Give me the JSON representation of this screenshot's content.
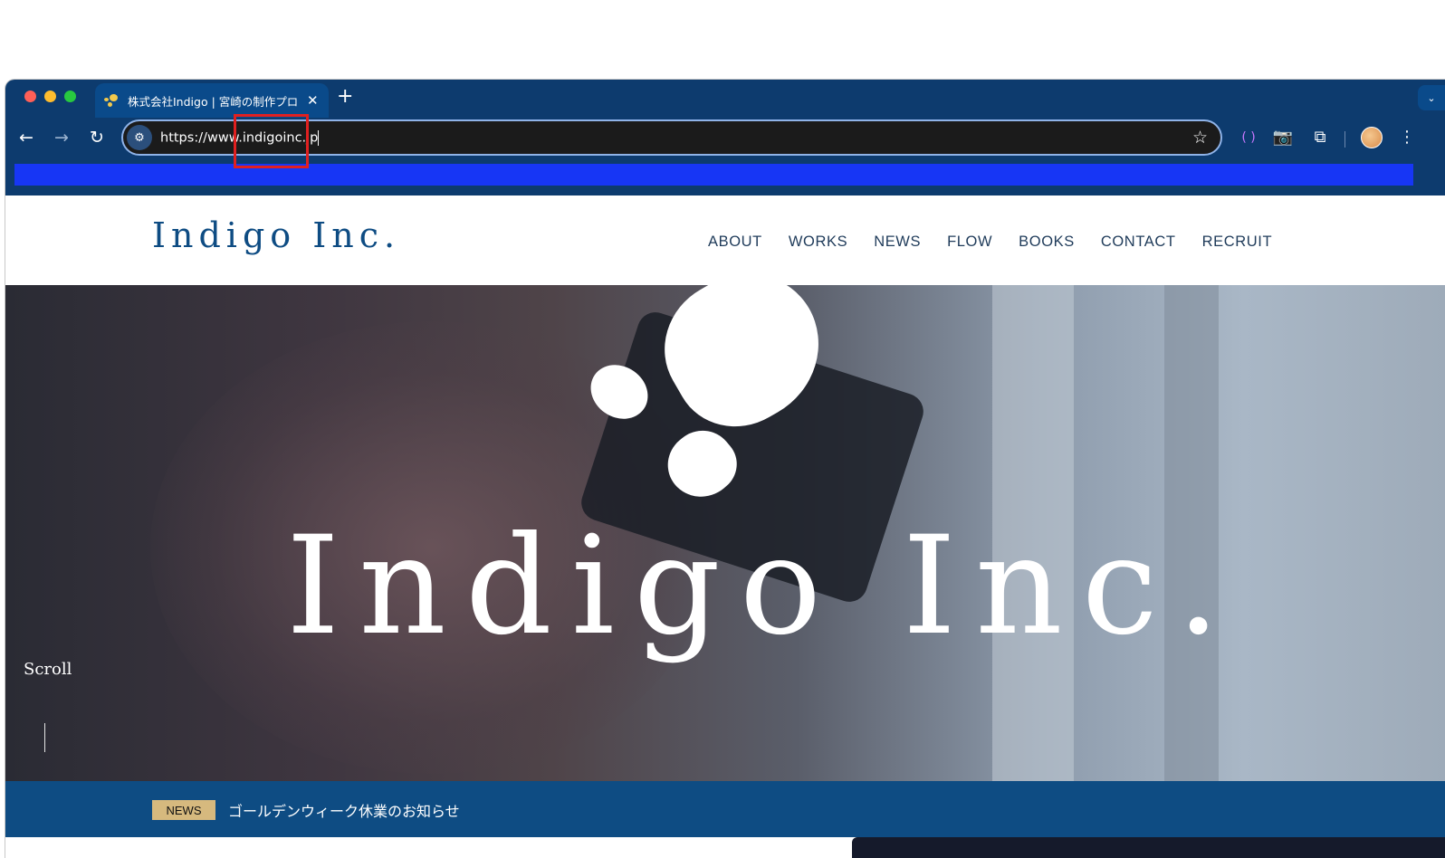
{
  "browser": {
    "tab_title": "株式会社Indigo | 宮崎の制作プロ",
    "tab_close": "✕",
    "new_tab": "+",
    "tab_dropdown": "⌄",
    "url": "https://www.indigoinc.jp",
    "url_typed": "https://www.indigoinc.jp",
    "icons": {
      "back": "←",
      "forward": "→",
      "reload": "↻",
      "site_info": "⚙",
      "bookmark": "☆",
      "extension_1": "( )",
      "extension_2": "📷",
      "extensions": "⧉",
      "menu": "⋮"
    },
    "colors": {
      "chrome": "#0d3b6e",
      "bookmark_bar": "#1736f5",
      "highlight": "#e02020"
    }
  },
  "site": {
    "logo": "Indigo Inc.",
    "nav": [
      "ABOUT",
      "WORKS",
      "NEWS",
      "FLOW",
      "BOOKS",
      "CONTACT",
      "RECRUIT"
    ],
    "hero_title": "Indigo Inc.",
    "scroll_label": "Scroll",
    "news_badge": "NEWS",
    "news_text": "ゴールデンウィーク休業のお知らせ",
    "colors": {
      "brand": "#0e4c83",
      "badge": "#d6b97e"
    }
  }
}
